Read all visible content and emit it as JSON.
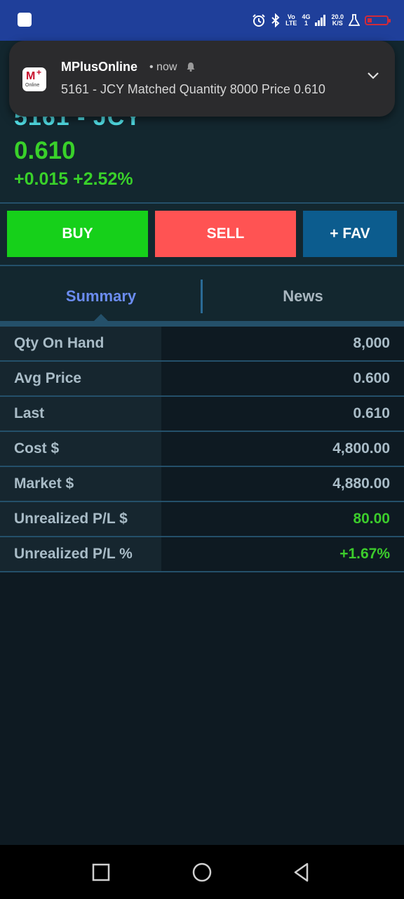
{
  "status_bar": {
    "net_top": "Vo",
    "net_bottom": "LTE",
    "signal_top": "4G",
    "signal_bottom": "1",
    "speed_top": "20.0",
    "speed_bottom": "K/S",
    "battery_color": "#d12b3a"
  },
  "notification": {
    "app_name": "MPlusOnline",
    "time": "• now",
    "body": "5161 - JCY Matched Quantity 8000 Price 0.610",
    "icon_text": "Online"
  },
  "stock": {
    "title": "5161 - JCY",
    "price": "0.610",
    "change": "+0.015 +2.52%"
  },
  "actions": {
    "buy": "BUY",
    "sell": "SELL",
    "fav": "+ FAV"
  },
  "tabs": [
    {
      "label": "Summary",
      "active": true
    },
    {
      "label": "News",
      "active": false
    }
  ],
  "summary": [
    {
      "label": "Qty On Hand",
      "value": "8,000"
    },
    {
      "label": "Avg Price",
      "value": "0.600"
    },
    {
      "label": "Last",
      "value": "0.610"
    },
    {
      "label": "Cost $",
      "value": "4,800.00"
    },
    {
      "label": "Market $",
      "value": "4,880.00"
    },
    {
      "label": "Unrealized P/L $",
      "value": "80.00",
      "positive": true
    },
    {
      "label": "Unrealized P/L %",
      "value": "+1.67%",
      "positive": true
    }
  ],
  "colors": {
    "buy": "#16d01a",
    "sell": "#ff5353",
    "fav": "#0c5c8e",
    "up": "#39d12a",
    "title": "#52e0e8"
  }
}
